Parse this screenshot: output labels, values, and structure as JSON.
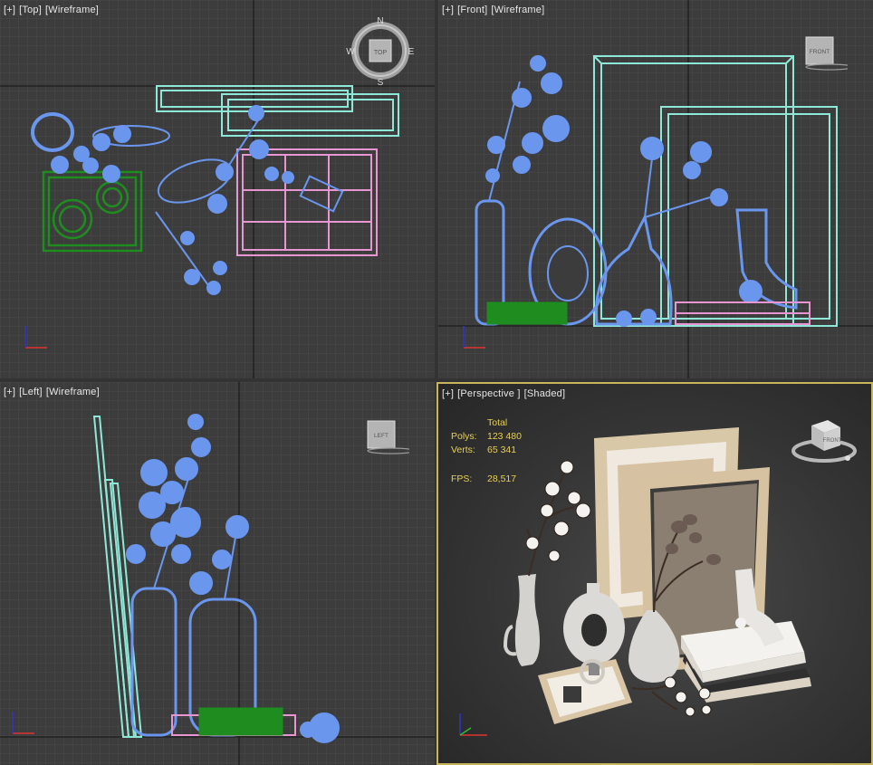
{
  "viewports": {
    "top": {
      "plus": "[+]",
      "view": "[Top]",
      "mode": "[Wireframe]",
      "cube_label": "TOP",
      "compass": {
        "n": "N",
        "e": "E",
        "s": "S",
        "w": "W"
      }
    },
    "front": {
      "plus": "[+]",
      "view": "[Front]",
      "mode": "[Wireframe]",
      "cube_label": "FRONT"
    },
    "left": {
      "plus": "[+]",
      "view": "[Left]",
      "mode": "[Wireframe]",
      "cube_label": "LEFT"
    },
    "perspective": {
      "plus": "[+]",
      "view": "[Perspective ]",
      "mode": "[Shaded]",
      "cube_label": "FRONT"
    }
  },
  "stats": {
    "header": "Total",
    "polys_label": "Polys:",
    "polys_value": "123 480",
    "verts_label": "Verts:",
    "verts_value": "65 341",
    "fps_label": "FPS:",
    "fps_value": "28,517"
  },
  "colors": {
    "viewport_bg": "#3c3c3c",
    "grid_minor": "#4a4a4a",
    "grid_major": "#262626",
    "active_border": "#c8b45a",
    "wire_blue": "#6a96ee",
    "wire_cyan": "#8ee8d8",
    "wire_green": "#1e8c1e",
    "wire_pink": "#e796d2",
    "stats_text": "#e8d050"
  }
}
